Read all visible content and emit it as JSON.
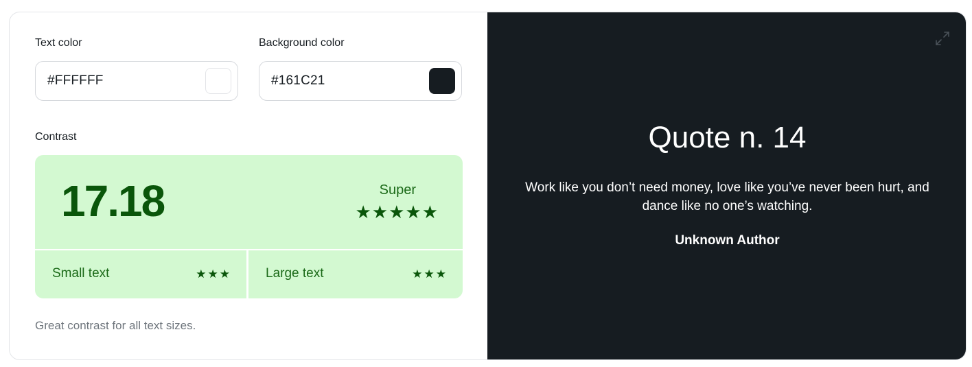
{
  "text_color": {
    "label": "Text color",
    "value": "#FFFFFF",
    "swatch": "#FFFFFF"
  },
  "background_color": {
    "label": "Background color",
    "value": "#161C21",
    "swatch": "#161C21"
  },
  "contrast": {
    "label": "Contrast",
    "ratio": "17.18",
    "rating": "Super",
    "rating_stars": 5,
    "small_text": {
      "label": "Small text",
      "stars": 3
    },
    "large_text": {
      "label": "Large text",
      "stars": 3
    },
    "description": "Great contrast for all text sizes."
  },
  "preview": {
    "expand_icon": "expand-icon",
    "title": "Quote n. 14",
    "quote": "Work like you don’t need money, love like you’ve never been hurt, and dance like no one’s watching.",
    "author": "Unknown Author"
  },
  "colors": {
    "good_bg": "#D3F9D1",
    "good_fg": "#0A560A",
    "preview_bg": "#161C21"
  }
}
